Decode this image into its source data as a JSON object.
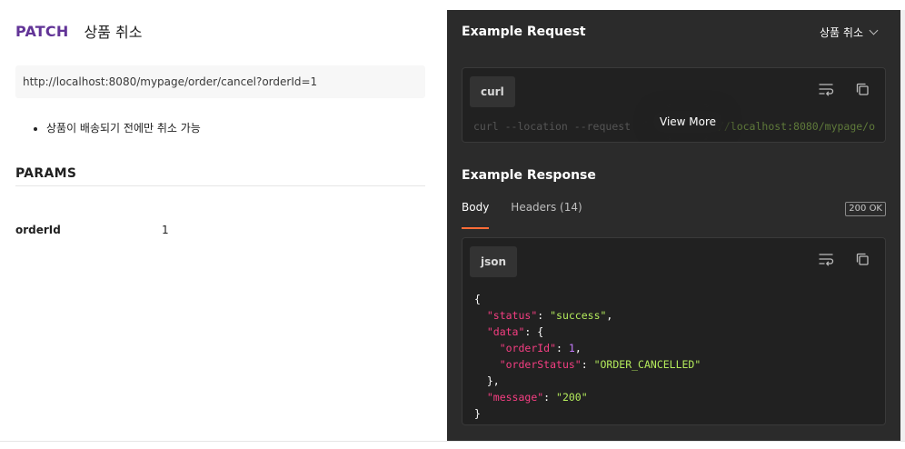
{
  "request": {
    "method": "PATCH",
    "name": "상품 취소",
    "url": "http://localhost:8080/mypage/order/cancel?orderId=1",
    "description_items": [
      "상품이 배송되기 전에만 취소 가능"
    ]
  },
  "params": {
    "title": "PARAMS",
    "rows": [
      {
        "key": "orderId",
        "value": "1"
      }
    ]
  },
  "example_request": {
    "title": "Example Request",
    "selected_example": "상품 취소",
    "language": "curl",
    "code_visible_start": "curl --location --request",
    "code_visible_end": "p://localhost:8080/mypage/o",
    "view_more_label": "View More"
  },
  "example_response": {
    "title": "Example Response",
    "tabs": [
      "Body",
      "Headers (14)"
    ],
    "active_tab": "Body",
    "status": "200 OK",
    "language": "json",
    "json": {
      "open_brace": "{",
      "status_key": "\"status\"",
      "status_value": "\"success\"",
      "data_key": "\"data\"",
      "order_id_key": "\"orderId\"",
      "order_id_value": "1",
      "order_status_key": "\"orderStatus\"",
      "order_status_value": "\"ORDER_CANCELLED\"",
      "message_key": "\"message\"",
      "message_value": "\"200\"",
      "close_brace": "}"
    }
  },
  "colors": {
    "method": "#623497",
    "panel_bg": "#2b2b2b",
    "code_bg": "#212121",
    "json_key": "#f53e82",
    "json_string": "#b3ea5b",
    "json_number": "#c67cff",
    "tab_accent": "#ff6c37"
  },
  "icons": [
    "wrap-lines-icon",
    "copy-icon",
    "chevron-down-icon"
  ]
}
